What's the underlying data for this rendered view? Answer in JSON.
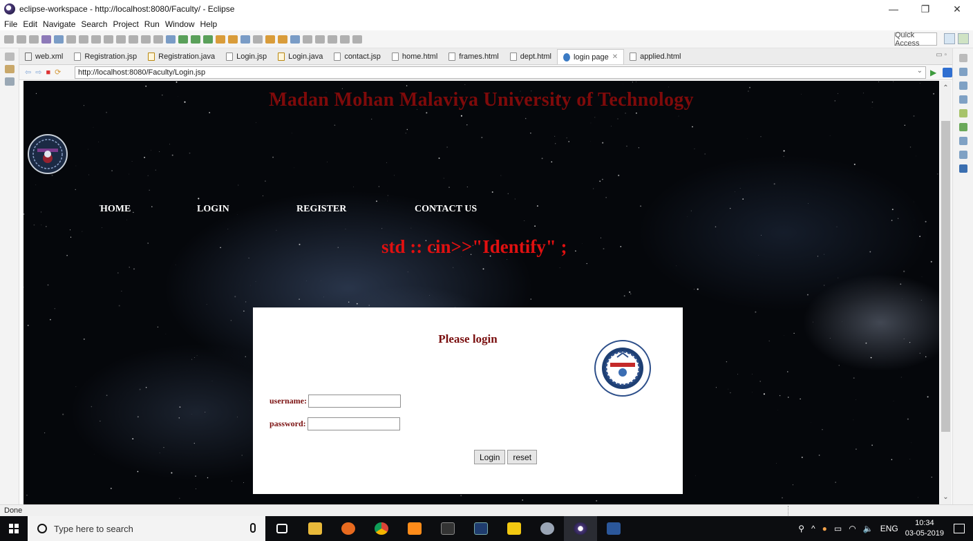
{
  "window": {
    "title": "eclipse-workspace - http://localhost:8080/Faculty/ - Eclipse",
    "minimize": "—",
    "maximize": "❐",
    "close": "✕"
  },
  "menu": [
    "File",
    "Edit",
    "Navigate",
    "Search",
    "Project",
    "Run",
    "Window",
    "Help"
  ],
  "toolbar": {
    "quick_access": "Quick Access"
  },
  "tabs": [
    {
      "label": "web.xml",
      "icon": "xml-file-icon"
    },
    {
      "label": "Registration.jsp",
      "icon": "jsp-file-icon"
    },
    {
      "label": "Registration.java",
      "icon": "java-file-icon"
    },
    {
      "label": "Login.jsp",
      "icon": "jsp-file-icon"
    },
    {
      "label": "Login.java",
      "icon": "java-file-icon"
    },
    {
      "label": "contact.jsp",
      "icon": "jsp-file-icon"
    },
    {
      "label": "home.html",
      "icon": "html-file-icon"
    },
    {
      "label": "frames.html",
      "icon": "html-file-icon"
    },
    {
      "label": "dept.html",
      "icon": "html-file-icon"
    },
    {
      "label": "login page",
      "icon": "globe-icon",
      "active": true
    },
    {
      "label": "applied.html",
      "icon": "html-file-icon"
    }
  ],
  "browser": {
    "url": "http://localhost:8080/Faculty/Login.jsp"
  },
  "page": {
    "site_title": "Madan Mohan Malaviya University of Technology",
    "nav": [
      "HOME",
      "LOGIN",
      "REGISTER",
      "CONTACT US"
    ],
    "tagline": "std :: cin>>\"Identify\" ;",
    "login": {
      "heading": "Please login",
      "username_label": "username:",
      "password_label": "password:",
      "username_value": "",
      "password_value": "",
      "login_button": "Login",
      "reset_button": "reset"
    }
  },
  "status": {
    "text": "Done"
  },
  "taskbar": {
    "search_placeholder": "Type here to search",
    "language": "ENG",
    "time": "10:34",
    "date": "03-05-2019"
  },
  "colors": {
    "title_red": "#7e0a0a",
    "tagline_red": "#e01010",
    "card_text": "#7a0f0f"
  }
}
